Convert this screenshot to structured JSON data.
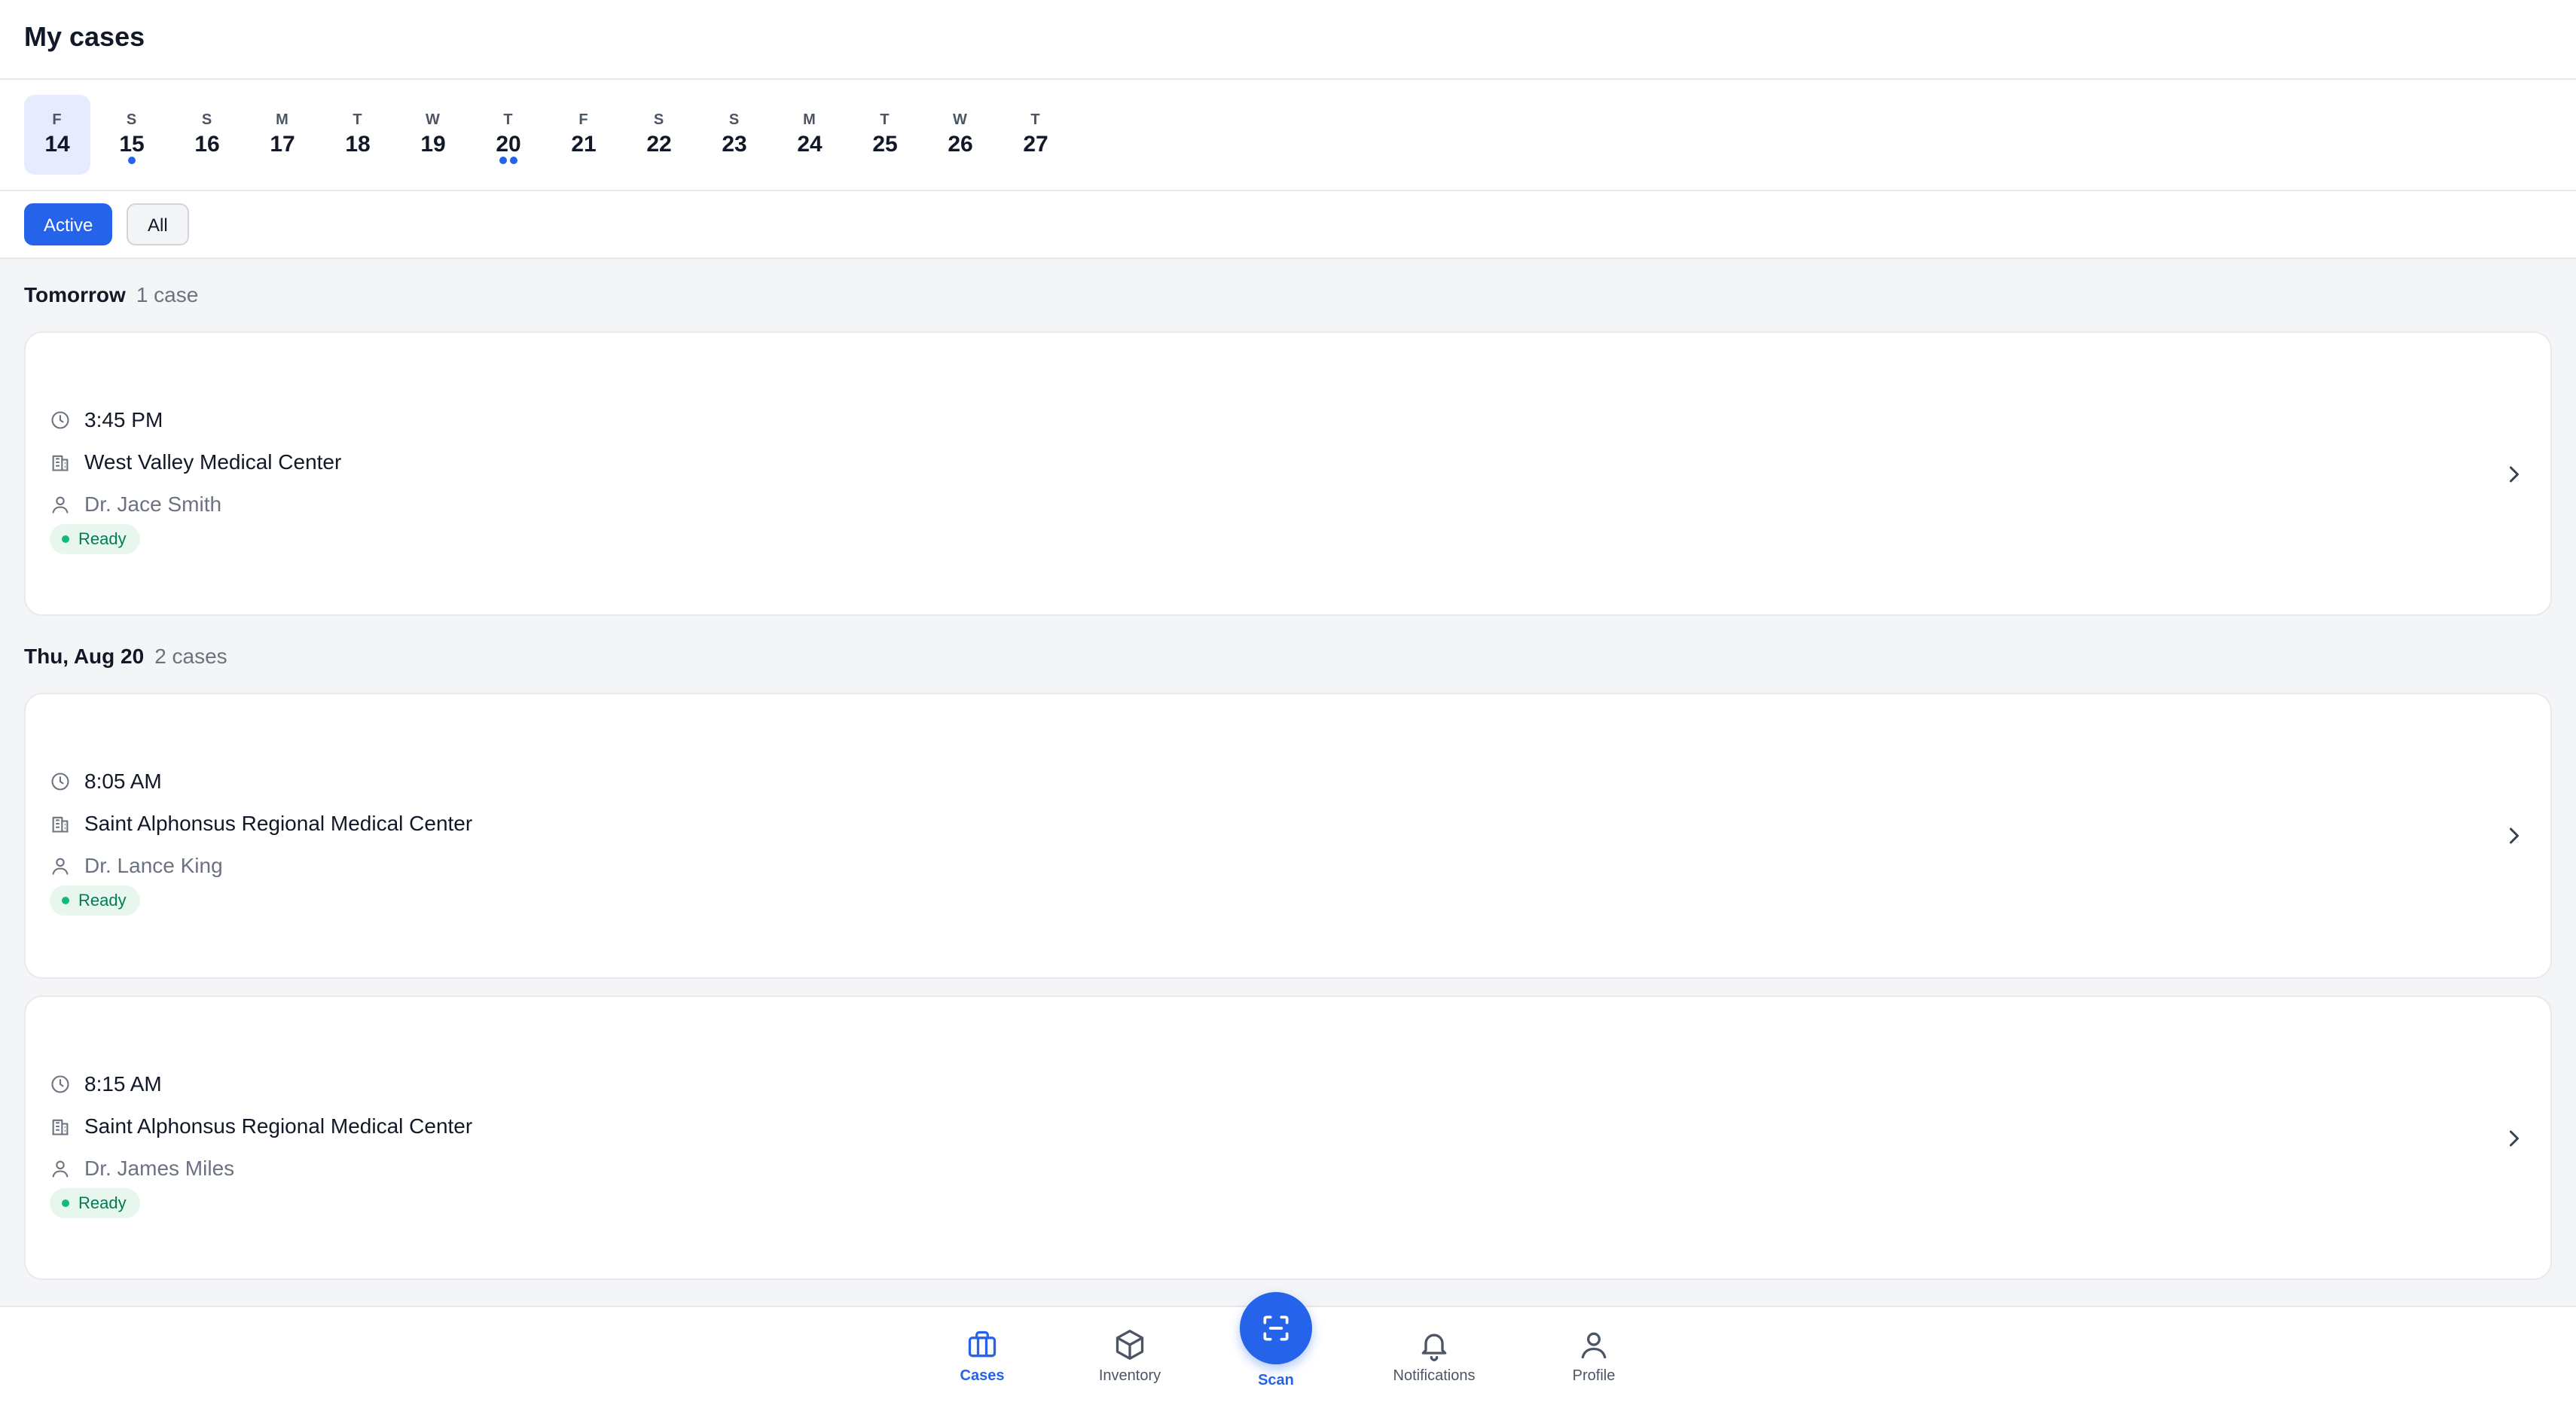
{
  "header": {
    "title": "My cases"
  },
  "dates": [
    {
      "letter": "F",
      "num": "14",
      "dots": 0,
      "selected": true
    },
    {
      "letter": "S",
      "num": "15",
      "dots": 1
    },
    {
      "letter": "S",
      "num": "16",
      "dots": 0
    },
    {
      "letter": "M",
      "num": "17",
      "dots": 0
    },
    {
      "letter": "T",
      "num": "18",
      "dots": 0
    },
    {
      "letter": "W",
      "num": "19",
      "dots": 0
    },
    {
      "letter": "T",
      "num": "20",
      "dots": 2
    },
    {
      "letter": "F",
      "num": "21",
      "dots": 0
    },
    {
      "letter": "S",
      "num": "22",
      "dots": 0
    },
    {
      "letter": "S",
      "num": "23",
      "dots": 0
    },
    {
      "letter": "M",
      "num": "24",
      "dots": 0
    },
    {
      "letter": "T",
      "num": "25",
      "dots": 0
    },
    {
      "letter": "W",
      "num": "26",
      "dots": 0
    },
    {
      "letter": "T",
      "num": "27",
      "dots": 0
    }
  ],
  "filters": {
    "active": "Active",
    "all": "All"
  },
  "sections": [
    {
      "title": "Tomorrow",
      "count": "1 case",
      "cases": [
        {
          "time": "3:45 PM",
          "facility": "West Valley Medical Center",
          "doctor": "Dr. Jace Smith",
          "status": "Ready"
        }
      ]
    },
    {
      "title": "Thu, Aug 20",
      "count": "2 cases",
      "cases": [
        {
          "time": "8:05 AM",
          "facility": "Saint Alphonsus Regional Medical Center",
          "doctor": "Dr. Lance King",
          "status": "Ready"
        },
        {
          "time": "8:15 AM",
          "facility": "Saint Alphonsus Regional Medical Center",
          "doctor": "Dr. James Miles",
          "status": "Ready"
        }
      ]
    }
  ],
  "nav": {
    "cases": "Cases",
    "inventory": "Inventory",
    "scan": "Scan",
    "notifications": "Notifications",
    "profile": "Profile"
  },
  "colors": {
    "accent": "#2563eb",
    "ready_bg": "#e7f7ee",
    "ready_text": "#047857"
  },
  "icons": {
    "time": "clock-icon",
    "facility": "building-icon",
    "doctor": "user-icon",
    "open": "chevron-right-icon"
  }
}
